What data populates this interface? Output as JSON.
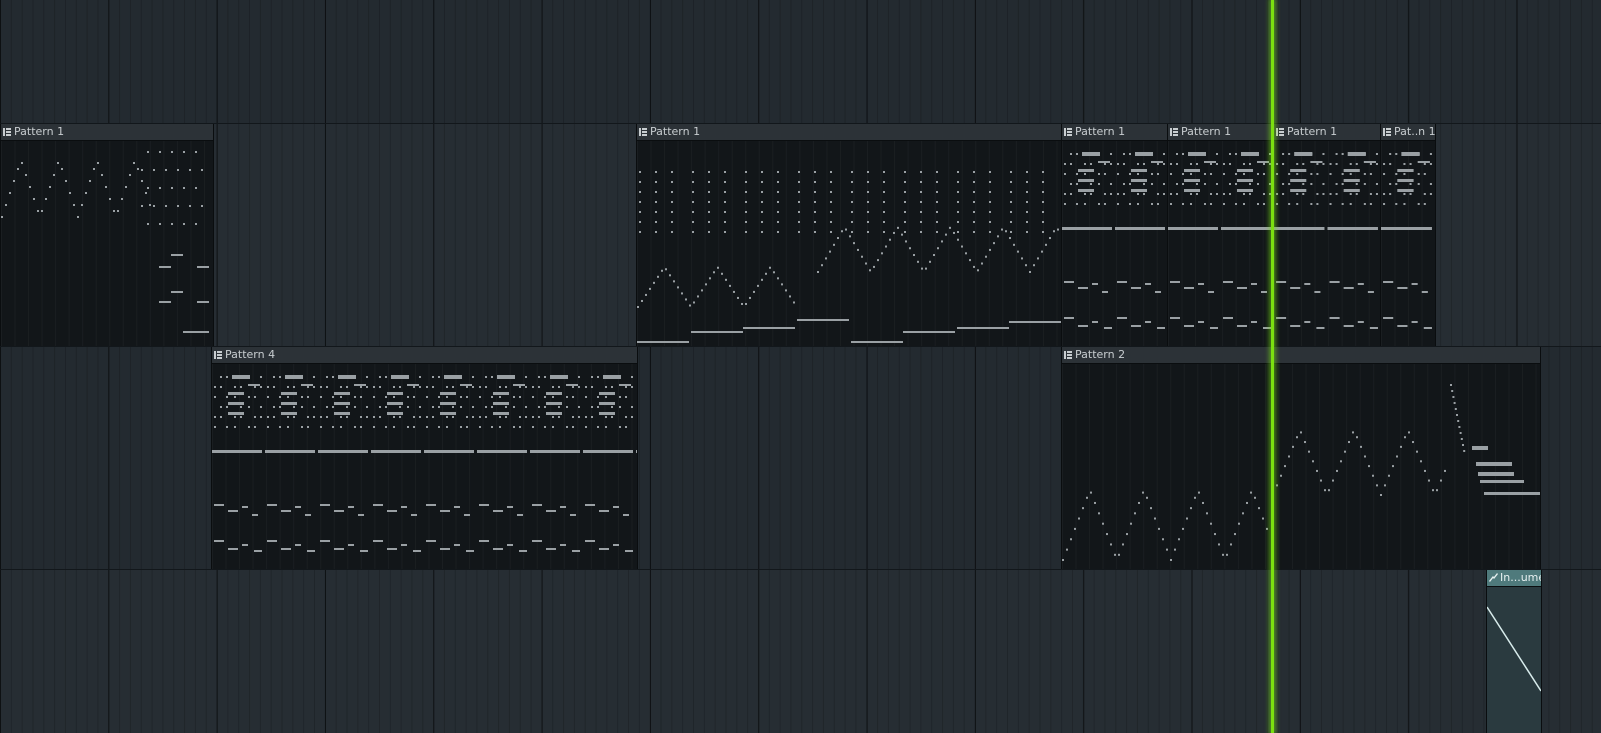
{
  "playlist": {
    "tracks": [
      {
        "id": "track-1",
        "clips": []
      },
      {
        "id": "track-2",
        "clips": [
          {
            "label": "Pattern 1",
            "pattern": "p1a"
          },
          {
            "label": "Pattern 1",
            "pattern": "p1b"
          },
          {
            "label": "Pattern 1",
            "pattern": "p3"
          },
          {
            "label": "Pattern 1",
            "pattern": "p3"
          },
          {
            "label": "Pattern 1",
            "pattern": "p3"
          },
          {
            "label": "Pat..n 1",
            "pattern": "p3"
          }
        ]
      },
      {
        "id": "track-3",
        "clips": [
          {
            "label": "Pattern 4",
            "pattern": "p4"
          },
          {
            "label": "Pattern 2",
            "pattern": "p2"
          }
        ]
      },
      {
        "id": "track-4",
        "clips": [
          {
            "label": "In...ume",
            "type": "automation"
          }
        ]
      }
    ]
  },
  "colors": {
    "playhead": "#7be010",
    "note": "#9aa0a4",
    "automation_header": "#4f7a7c",
    "automation_line": "#d8ecec"
  }
}
